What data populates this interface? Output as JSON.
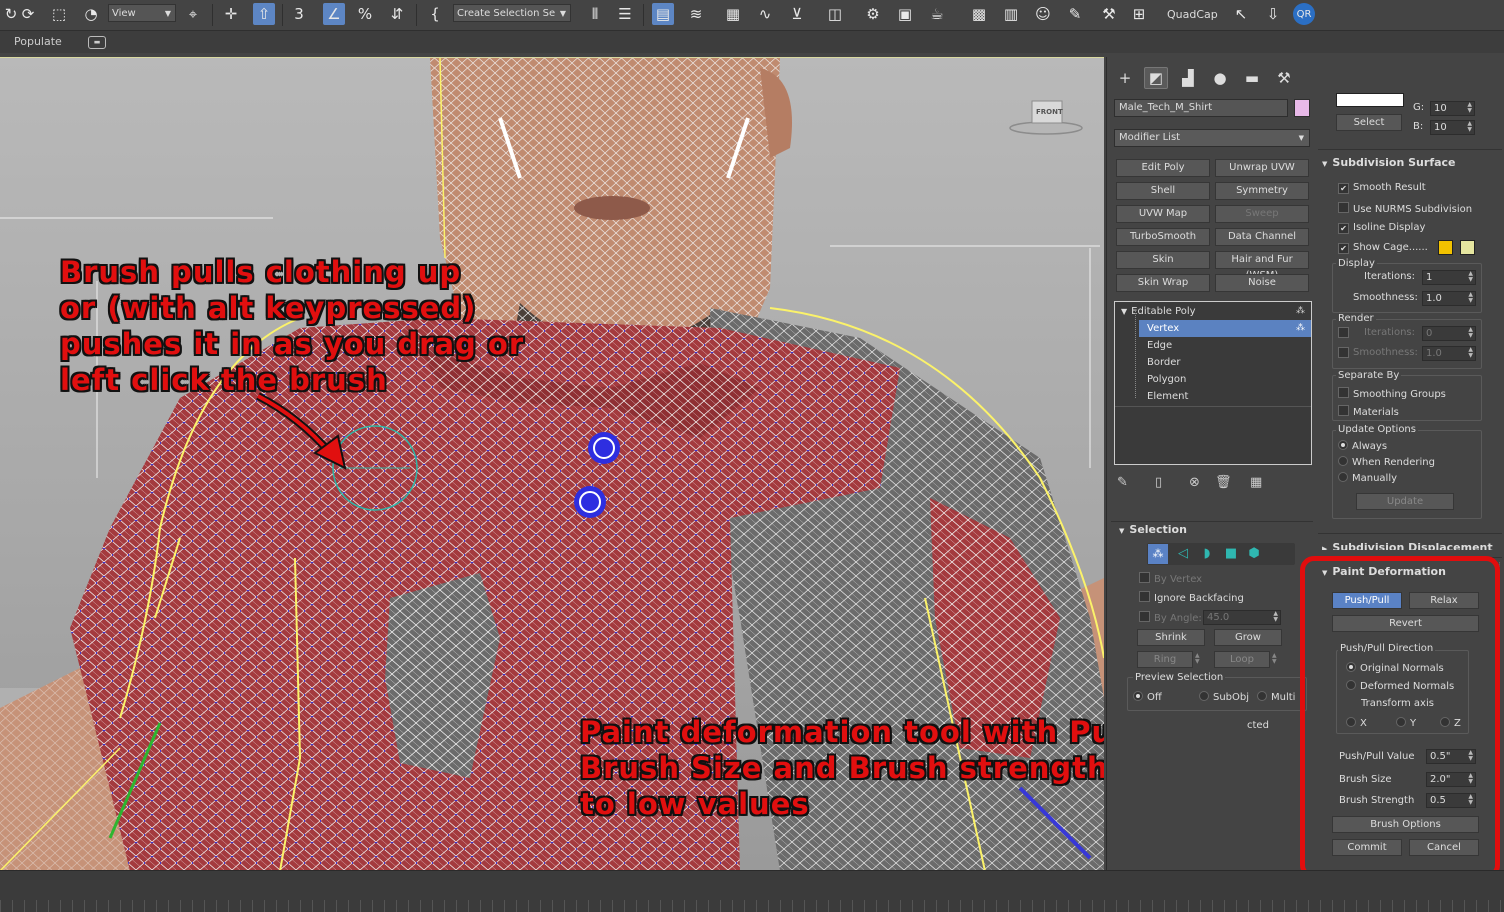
{
  "toolbar": {
    "view_dropdown": "View",
    "selection_set_dropdown": "Create Selection Se",
    "quadcap_label": "QuadCap"
  },
  "ribbon": {
    "populate_label": "Populate"
  },
  "viewport": {
    "viewcube_label": "FRONT",
    "annotation_top": [
      "Brush pulls clothing up",
      "or (with alt keypressed)",
      "pushes it in as you drag or",
      "left click the brush"
    ],
    "annotation_bottom": [
      "Paint deformation tool with Push/pull,",
      "Brush Size and Brush strength adjusted",
      "to low values"
    ]
  },
  "command_panel": {
    "object_name": "Male_Tech_M_Shirt",
    "object_color": "#e8b9e8",
    "modifier_list": "Modifier List",
    "modifier_buttons": [
      {
        "label": "Edit Poly",
        "enabled": true
      },
      {
        "label": "Unwrap UVW",
        "enabled": true
      },
      {
        "label": "Shell",
        "enabled": true
      },
      {
        "label": "Symmetry",
        "enabled": true
      },
      {
        "label": "UVW Map",
        "enabled": true
      },
      {
        "label": "Sweep",
        "enabled": false
      },
      {
        "label": "TurboSmooth",
        "enabled": true
      },
      {
        "label": "Data Channel",
        "enabled": true
      },
      {
        "label": "Skin",
        "enabled": true
      },
      {
        "label": "Hair and Fur (WSM)",
        "enabled": true
      },
      {
        "label": "Skin Wrap",
        "enabled": true
      },
      {
        "label": "Noise",
        "enabled": true
      }
    ],
    "stack": {
      "root": "Editable Poly",
      "items": [
        "Vertex",
        "Edge",
        "Border",
        "Polygon",
        "Element"
      ],
      "selected": "Vertex"
    },
    "selection": {
      "title": "Selection",
      "by_vertex": "By Vertex",
      "ignore_backfacing": "Ignore Backfacing",
      "by_angle": "By Angle:",
      "by_angle_value": "45.0",
      "shrink": "Shrink",
      "grow": "Grow",
      "ring": "Ring",
      "loop": "Loop",
      "preview_selection": "Preview Selection",
      "preview_options": [
        "Off",
        "SubObj",
        "Multi"
      ],
      "partial_text": "cted"
    }
  },
  "right_panel": {
    "color_select_button": "Select",
    "g_label": "G:",
    "g_value": "10",
    "b_label": "B:",
    "b_value": "10",
    "subdivision": {
      "title": "Subdivision Surface",
      "smooth_result": "Smooth Result",
      "use_nurms": "Use NURMS Subdivision",
      "isoline_display": "Isoline Display",
      "show_cage": "Show Cage......",
      "cage_color_1": "#f2c200",
      "cage_color_2": "#e6e6a0",
      "display_label": "Display",
      "iterations_label": "Iterations:",
      "iterations_value": "1",
      "smoothness_label": "Smoothness:",
      "smoothness_value": "1.0",
      "render_label": "Render",
      "render_iterations_label": "Iterations:",
      "render_iterations_value": "0",
      "render_smoothness_label": "Smoothness:",
      "render_smoothness_value": "1.0",
      "separate_by": "Separate By",
      "smoothing_groups": "Smoothing Groups",
      "materials": "Materials",
      "update_options": "Update Options",
      "always": "Always",
      "when_rendering": "When Rendering",
      "manually": "Manually",
      "update_button": "Update"
    },
    "subdivision_displacement_title": "Subdivision Displacement",
    "paint_deformation": {
      "title": "Paint Deformation",
      "push_pull": "Push/Pull",
      "relax": "Relax",
      "revert": "Revert",
      "direction_label": "Push/Pull Direction",
      "original_normals": "Original Normals",
      "deformed_normals": "Deformed Normals",
      "transform_axis": "Transform axis",
      "x": "X",
      "y": "Y",
      "z": "Z",
      "push_pull_value_label": "Push/Pull Value",
      "push_pull_value": "0.5\"",
      "brush_size_label": "Brush Size",
      "brush_size_value": "2.0\"",
      "brush_strength_label": "Brush Strength",
      "brush_strength_value": "0.5",
      "brush_options": "Brush Options",
      "commit": "Commit",
      "cancel": "Cancel"
    }
  }
}
